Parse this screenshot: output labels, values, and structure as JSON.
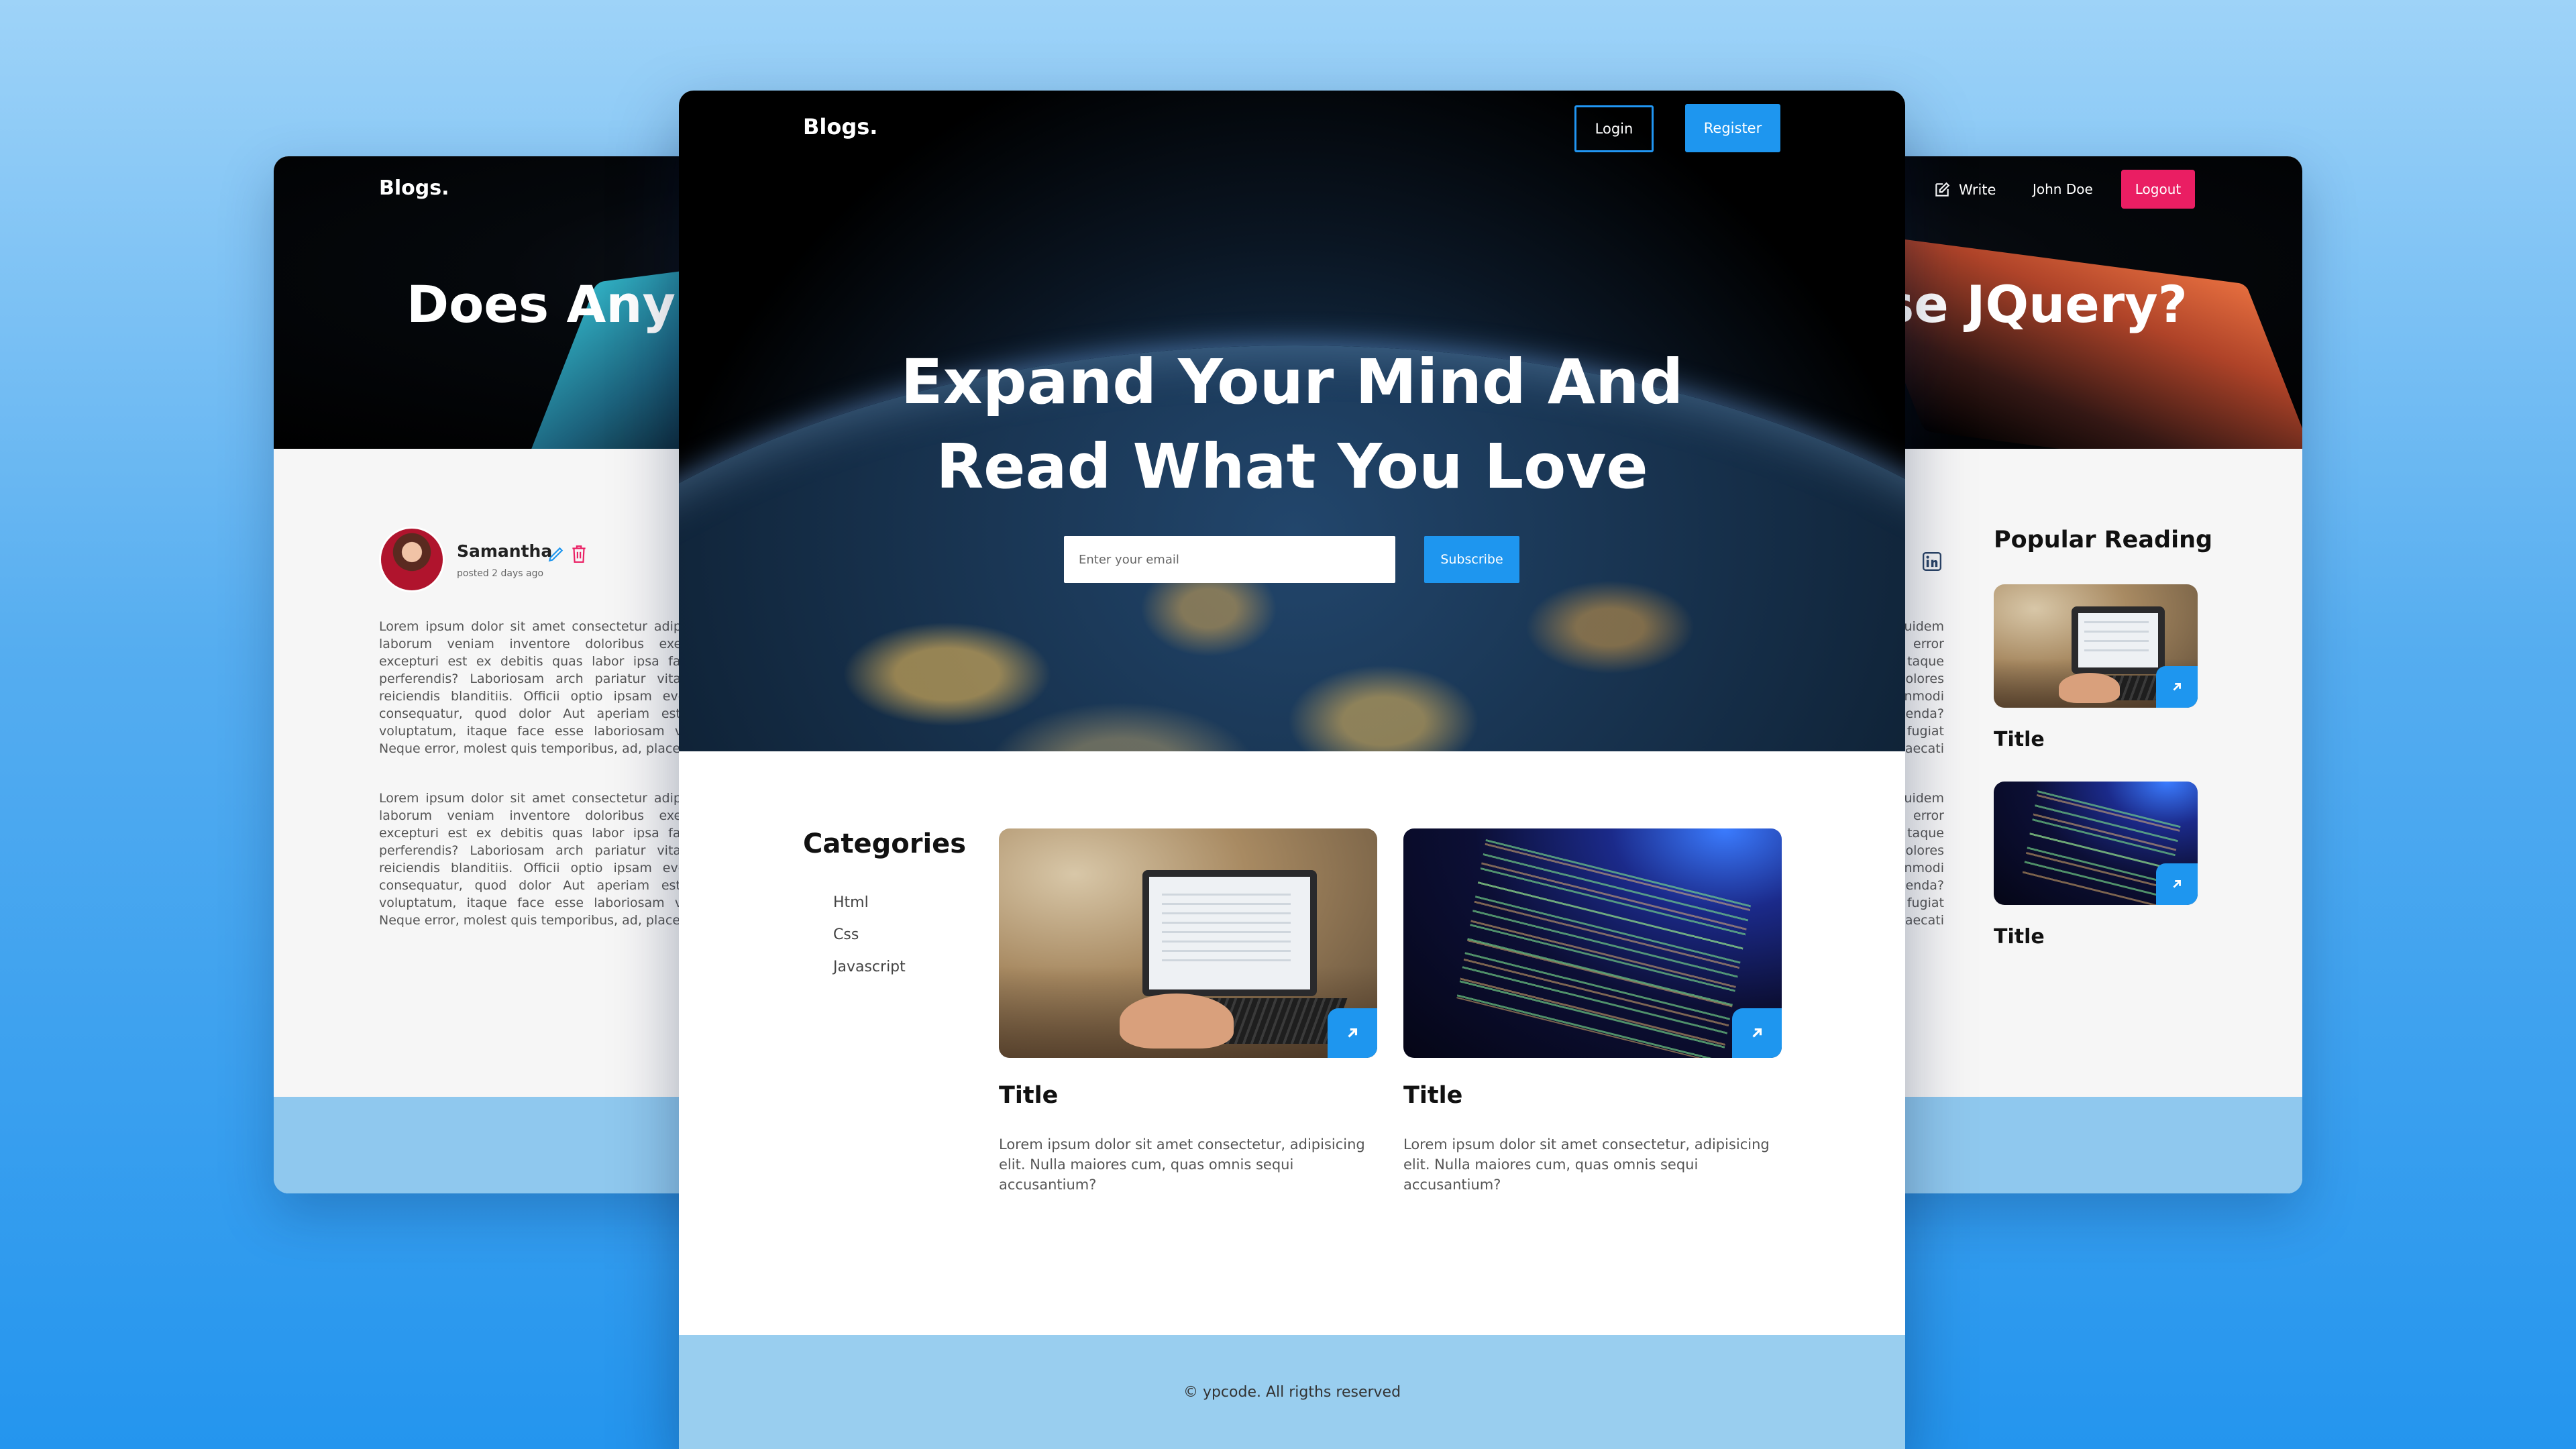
{
  "back_window": {
    "logo": "Blogs",
    "logo_dot": ".",
    "post_title_left": "Does Anyb",
    "post_title_right": "se JQuery?",
    "nav": {
      "write_label": "Write",
      "user_name": "John Doe",
      "logout_label": "Logout"
    },
    "author": {
      "name": "Samantha",
      "posted": "posted 2 days ago"
    },
    "paragraphs": [
      "Lorem ipsum dolor sit amet consectetur adipisi aperiam laborum veniam inventore doloribus exercitationem excepturi est ex debitis quas labor ipsa facilis officiis perferendis? Laboriosam arch pariatur vitae voluptas reiciendis blanditiis. Officii optio ipsam eveniet porro consequatur, quod dolor Aut aperiam est sed cum voluptatum, itaque face esse laboriosam voluptatem? Neque error, molest quis temporibus, ad, placeat sequi!",
      "Lorem ipsum dolor sit amet consectetur adipisi aperiam laborum veniam inventore doloribus exercitationem excepturi est ex debitis quas labor ipsa facilis officiis perferendis? Laboriosam arch pariatur vitae voluptas reiciendis blanditiis. Officii optio ipsam eveniet porro consequatur, quod dolor Aut aperiam est sed cum voluptatum, itaque face esse laboriosam voluptatem? Neque error, molest quis temporibus, ad, placeat sequi!"
    ],
    "right_fragments_1": [
      "uidem",
      "error",
      "taque",
      "olores",
      "nmodi",
      "enda?",
      "fugiat",
      "aecati"
    ],
    "right_fragments_2": [
      "uidem",
      "error",
      "taque",
      "olores",
      "nmodi",
      "enda?",
      "fugiat",
      "aecati"
    ],
    "popular": {
      "heading": "Popular Reading",
      "items": [
        {
          "title": "Title"
        },
        {
          "title": "Title"
        }
      ]
    }
  },
  "front_window": {
    "logo": "Blogs",
    "logo_dot": ".",
    "login_label": "Login",
    "register_label": "Register",
    "hero_line_1": "Expand Your Mind And",
    "hero_line_2": "Read What You Love",
    "email_placeholder": "Enter your email",
    "subscribe_label": "Subscribe",
    "categories": {
      "heading": "Categories",
      "items": [
        "Html",
        "Css",
        "Javascript"
      ]
    },
    "cards": [
      {
        "title": "Title",
        "description": "Lorem ipsum dolor sit amet consectetur, adipisicing elit. Nulla maiores cum, quas omnis sequi accusantium?"
      },
      {
        "title": "Title",
        "description": "Lorem ipsum dolor sit amet consectetur, adipisicing elit. Nulla maiores cum, quas omnis sequi accusantium?"
      }
    ],
    "footer": "© ypcode. All rigths reserved"
  },
  "colors": {
    "accent_blue": "#1e96ef",
    "logout_pink": "#ea1e63",
    "footer_blue": "#99ceef"
  },
  "icons": [
    "edit-icon",
    "trash-icon",
    "write-icon",
    "linkedin-icon",
    "arrow-up-right-icon"
  ]
}
